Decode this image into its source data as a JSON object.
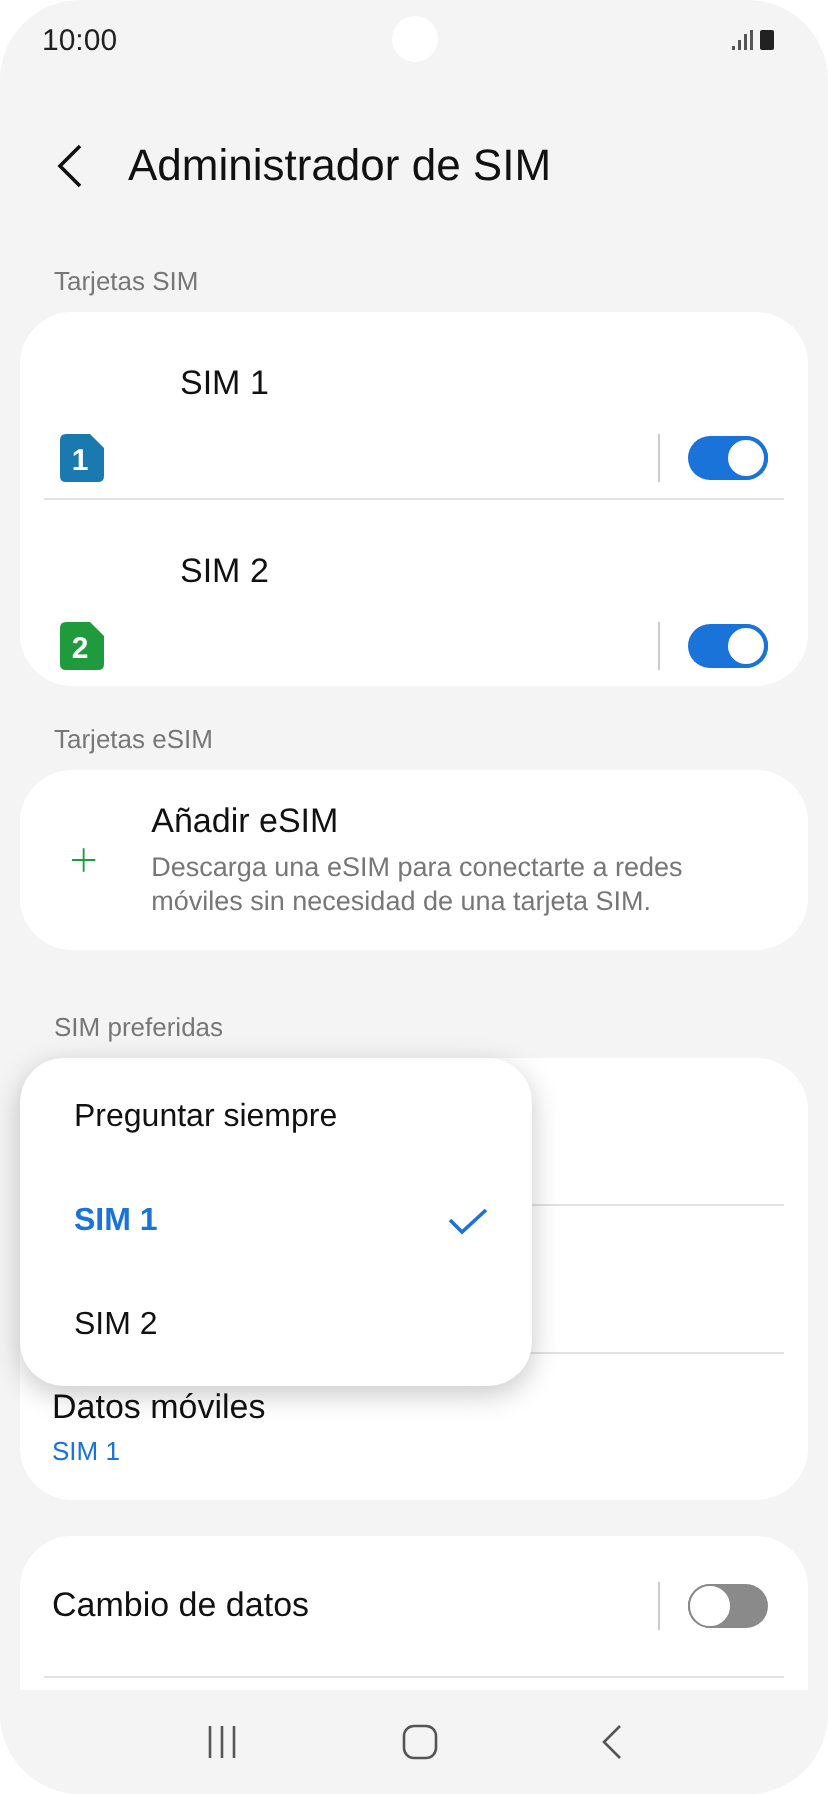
{
  "status_bar": {
    "time": "10:00"
  },
  "header": {
    "title": "Administrador de SIM"
  },
  "sim_section": {
    "label": "Tarjetas SIM",
    "cards": [
      {
        "name": "SIM 1",
        "number": "1",
        "color": "#1a7ab0",
        "on": true
      },
      {
        "name": "SIM 2",
        "number": "2",
        "color": "#1f9a3c",
        "on": true
      }
    ]
  },
  "esim_section": {
    "label": "Tarjetas eSIM",
    "title": "Añadir eSIM",
    "description": "Descarga una eSIM para conectarte a redes móviles sin necesidad de una tarjeta SIM."
  },
  "preferred_section": {
    "label": "SIM preferidas",
    "data_row": {
      "title": "Datos móviles",
      "value": "SIM 1"
    },
    "menu": [
      {
        "label": "Preguntar siempre",
        "selected": false
      },
      {
        "label": "SIM 1",
        "selected": true
      },
      {
        "label": "SIM 2",
        "selected": false
      }
    ]
  },
  "data_switch": {
    "label": "Cambio de datos",
    "on": false
  }
}
